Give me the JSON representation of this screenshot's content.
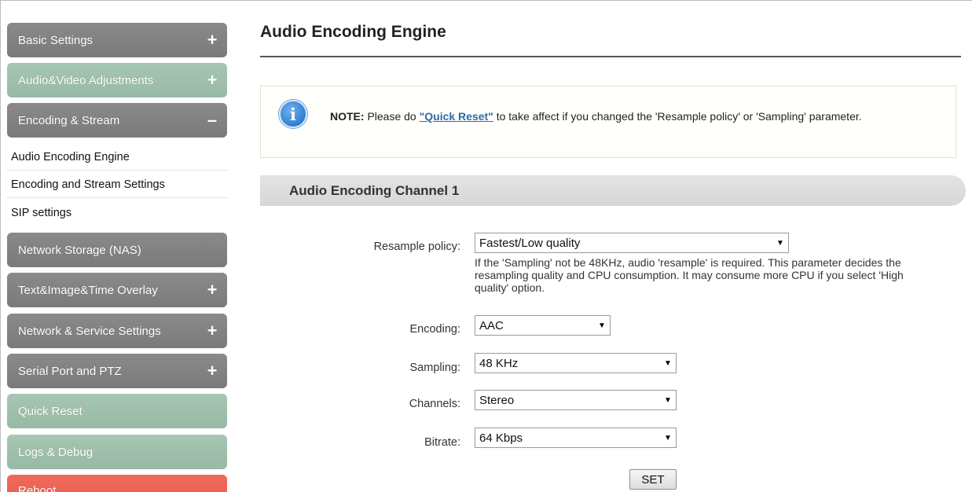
{
  "sidebar": {
    "items": [
      {
        "label": "Basic Settings",
        "toggle": "+"
      },
      {
        "label": "Audio&Video Adjustments",
        "toggle": "+"
      },
      {
        "label": "Encoding & Stream",
        "toggle": "–"
      },
      {
        "label": "Network Storage (NAS)",
        "toggle": ""
      },
      {
        "label": "Text&Image&Time Overlay",
        "toggle": "+"
      },
      {
        "label": "Network & Service Settings",
        "toggle": "+"
      },
      {
        "label": "Serial Port and PTZ",
        "toggle": "+"
      },
      {
        "label": "Quick Reset",
        "toggle": ""
      },
      {
        "label": "Logs & Debug",
        "toggle": ""
      },
      {
        "label": "Reboot",
        "toggle": ""
      }
    ],
    "subitems": [
      {
        "label": "Audio Encoding Engine"
      },
      {
        "label": "Encoding and Stream Settings"
      },
      {
        "label": "SIP settings"
      }
    ]
  },
  "main": {
    "title": "Audio Encoding Engine",
    "note": {
      "prefix": "NOTE:",
      "before_link": " Please do ",
      "link": "\"Quick Reset\"",
      "after_link": " to take affect if you changed the 'Resample policy' or 'Sampling' parameter."
    },
    "section_title": "Audio Encoding Channel 1",
    "form": {
      "resample_label": "Resample policy:",
      "resample_value": "Fastest/Low quality",
      "resample_help": "If the 'Sampling' not be 48KHz, audio 'resample' is required. This parameter decides the resampling quality and CPU consumption. It may consume more CPU if you select 'High quality' option.",
      "encoding_label": "Encoding:",
      "encoding_value": "AAC",
      "sampling_label": "Sampling:",
      "sampling_value": "48 KHz",
      "channels_label": "Channels:",
      "channels_value": "Stereo",
      "bitrate_label": "Bitrate:",
      "bitrate_value": "64 Kbps",
      "set_label": "SET",
      "dropdown_arrow": "▼"
    }
  },
  "colors": {
    "menu_gray": "#7f7f7f",
    "menu_green": "#9dbea9",
    "menu_red": "#ec5e50",
    "link": "#2d6da8"
  }
}
